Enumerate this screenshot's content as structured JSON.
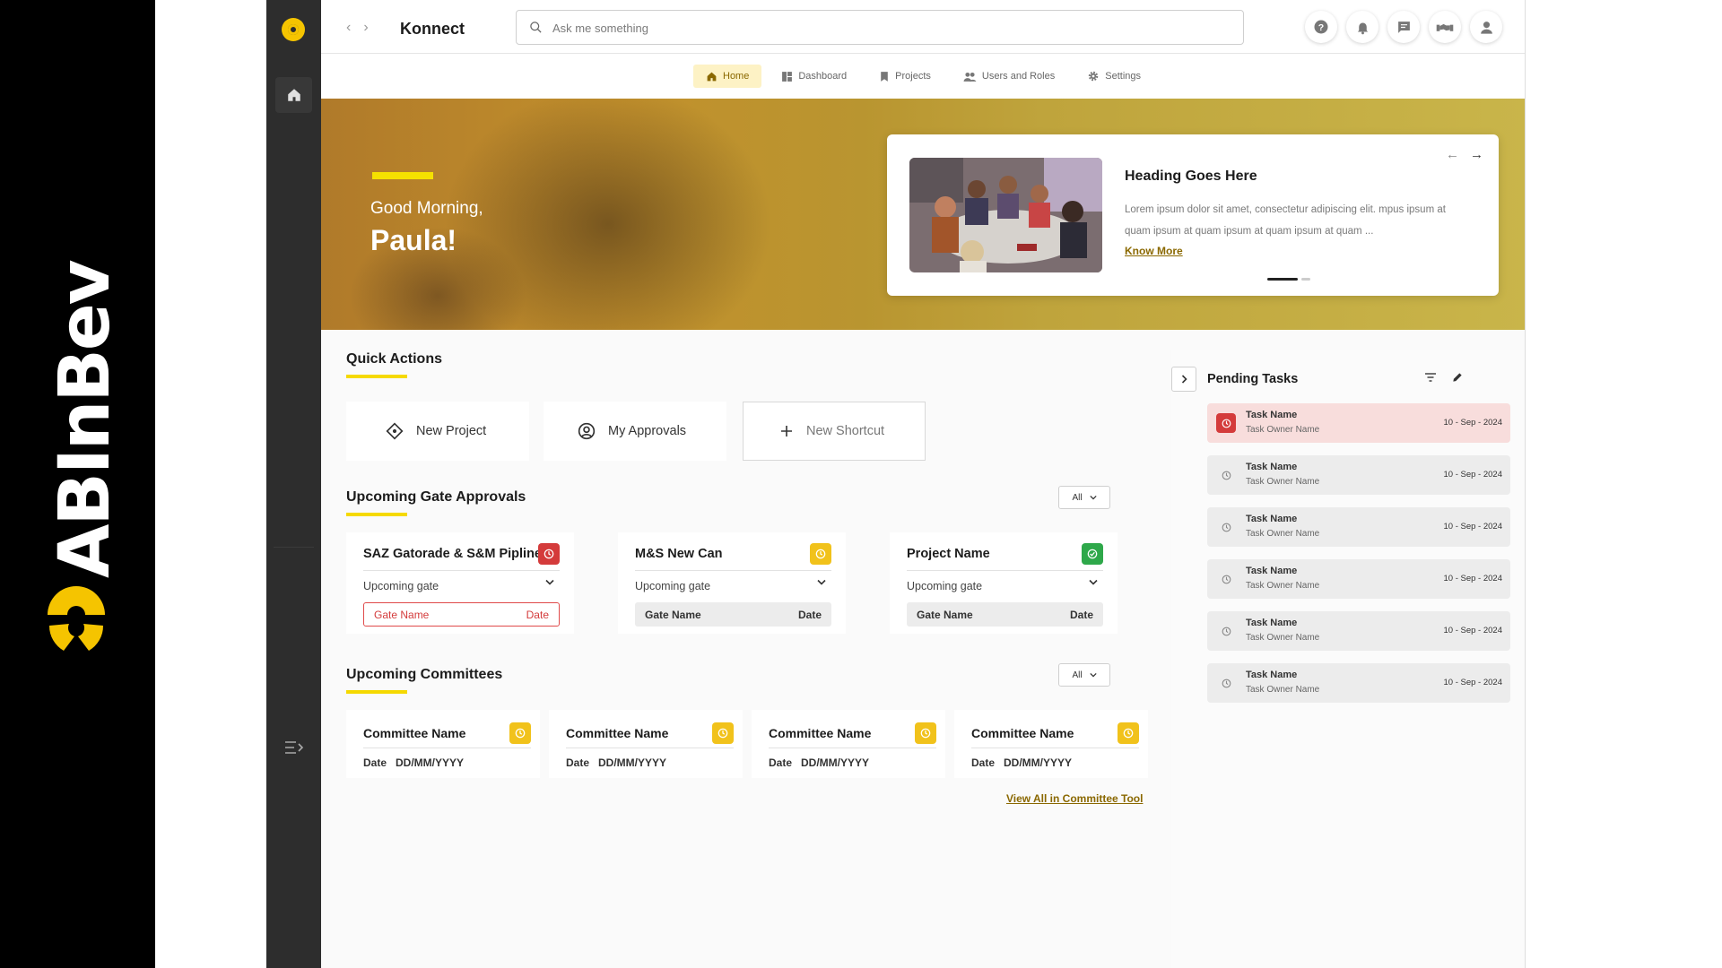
{
  "brand": {
    "name": "ABInBev"
  },
  "header": {
    "app_title": "Konnect",
    "search_placeholder": "Ask me something",
    "icons": [
      "help-icon",
      "bell-icon",
      "chat-icon",
      "handshake-icon",
      "user-icon"
    ]
  },
  "nav": {
    "tabs": [
      {
        "label": "Home",
        "icon": "home-icon",
        "active": true
      },
      {
        "label": "Dashboard",
        "icon": "dashboard-icon",
        "active": false
      },
      {
        "label": "Projects",
        "icon": "bookmark-icon",
        "active": false
      },
      {
        "label": "Users and Roles",
        "icon": "users-icon",
        "active": false
      },
      {
        "label": "Settings",
        "icon": "gear-icon",
        "active": false
      }
    ]
  },
  "hero": {
    "greeting": "Good Morning,",
    "name": "Paula!",
    "card": {
      "heading": "Heading Goes Here",
      "body": "Lorem ipsum dolor sit amet, consectetur adipiscing elit. mpus ipsum at quam  ipsum at quam  ipsum at quam ipsum at quam ...",
      "link": "Know More",
      "slide_index": 1,
      "slide_count": 2
    }
  },
  "quick_actions": {
    "title": "Quick Actions",
    "items": [
      {
        "label": "New Project",
        "icon": "diamond-icon"
      },
      {
        "label": "My Approvals",
        "icon": "user-circle-icon"
      },
      {
        "label": "New Shortcut",
        "icon": "plus-icon"
      }
    ]
  },
  "gate_approvals": {
    "title": "Upcoming Gate Approvals",
    "filter": "All",
    "cards": [
      {
        "name": "SAZ Gatorade & S&M Pipline",
        "status": "overdue",
        "status_color": "#d43b3b",
        "upcoming_label": "Upcoming gate",
        "gate_label": "Gate Name",
        "date_label": "Date"
      },
      {
        "name": "M&S New Can",
        "status": "pending",
        "status_color": "#f1c21b",
        "upcoming_label": "Upcoming gate",
        "gate_label": "Gate Name",
        "date_label": "Date"
      },
      {
        "name": "Project Name",
        "status": "done",
        "status_color": "#2ea84a",
        "upcoming_label": "Upcoming gate",
        "gate_label": "Gate Name",
        "date_label": "Date"
      }
    ]
  },
  "committees": {
    "title": "Upcoming Committees",
    "filter": "All",
    "cards": [
      {
        "name": "Committee Name",
        "date_label": "Date",
        "date_value": "DD/MM/YYYY"
      },
      {
        "name": "Committee Name",
        "date_label": "Date",
        "date_value": "DD/MM/YYYY"
      },
      {
        "name": "Committee Name",
        "date_label": "Date",
        "date_value": "DD/MM/YYYY"
      },
      {
        "name": "Committee Name",
        "date_label": "Date",
        "date_value": "DD/MM/YYYY"
      }
    ],
    "view_all": "View All in Committee Tool"
  },
  "pending_tasks": {
    "title": "Pending Tasks",
    "tasks": [
      {
        "name": "Task Name",
        "owner": "Task Owner Name",
        "date": "10 - Sep - 2024",
        "overdue": true
      },
      {
        "name": "Task Name",
        "owner": "Task Owner Name",
        "date": "10 - Sep - 2024",
        "overdue": false
      },
      {
        "name": "Task Name",
        "owner": "Task Owner Name",
        "date": "10 - Sep - 2024",
        "overdue": false
      },
      {
        "name": "Task Name",
        "owner": "Task Owner Name",
        "date": "10 - Sep - 2024",
        "overdue": false
      },
      {
        "name": "Task Name",
        "owner": "Task Owner Name",
        "date": "10 - Sep - 2024",
        "overdue": false
      },
      {
        "name": "Task Name",
        "owner": "Task Owner Name",
        "date": "10 - Sep - 2024",
        "overdue": false
      }
    ]
  },
  "colors": {
    "accent": "#f5d900",
    "sidebar": "#2d2d2d",
    "link": "#8a6800"
  }
}
